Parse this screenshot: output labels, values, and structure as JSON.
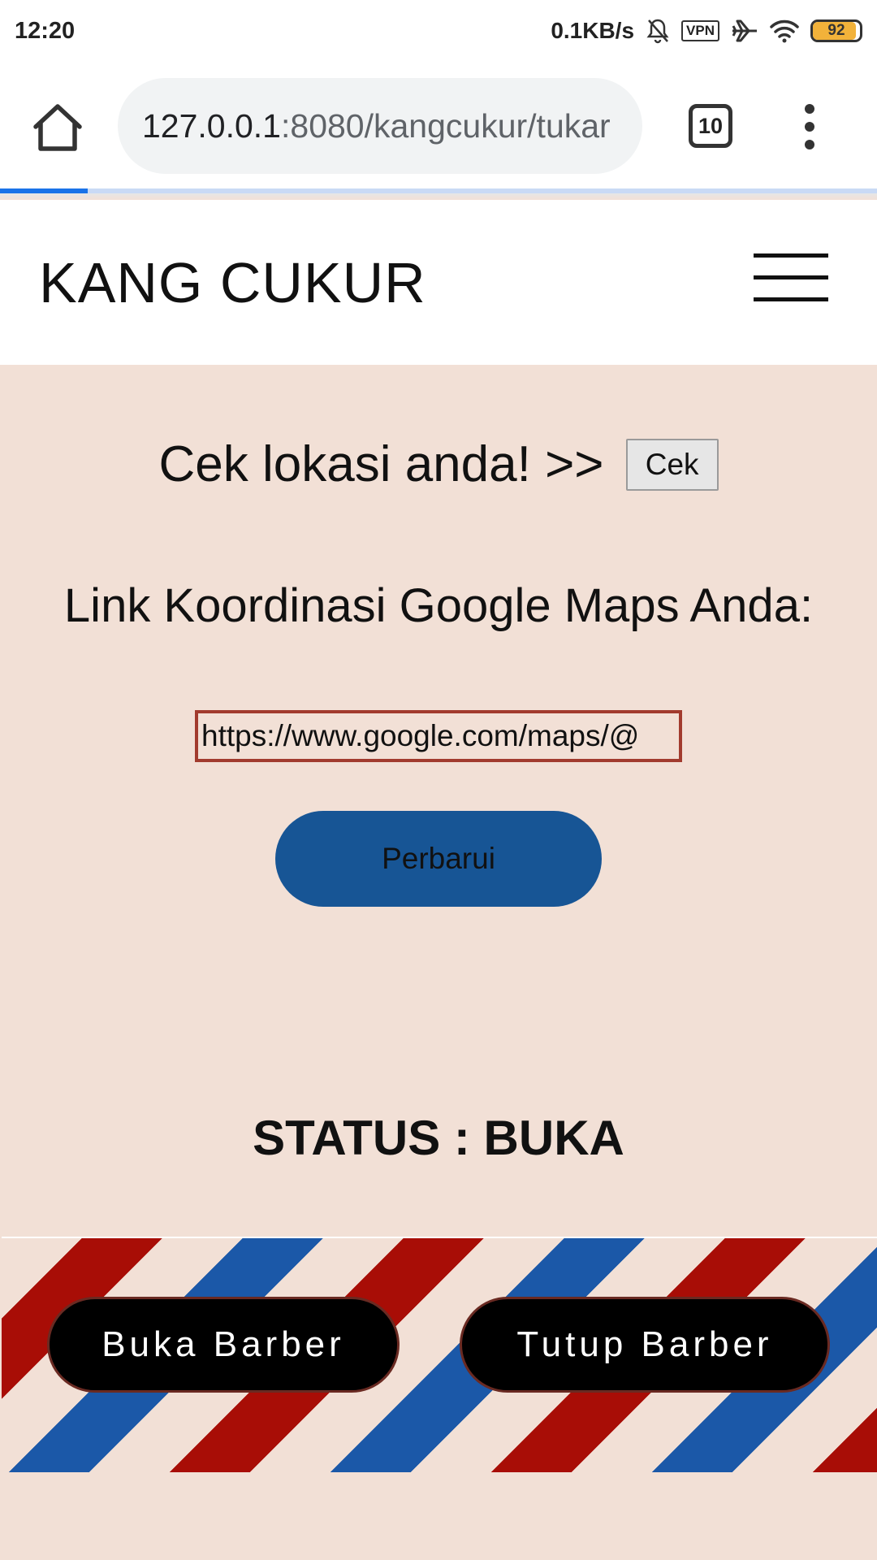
{
  "status_bar": {
    "time": "12:20",
    "network_speed": "0.1KB/s",
    "vpn_label": "VPN",
    "battery_level": "92",
    "icons": [
      "bell-muted-icon",
      "vpn-icon",
      "airplane-icon",
      "wifi-icon",
      "battery-icon"
    ]
  },
  "browser": {
    "url_host": "127.0.0.1",
    "url_path": ":8080/kangcukur/tukar",
    "tab_count": "10",
    "page_load_progress": 0.1
  },
  "site": {
    "title": "KANG CUKUR"
  },
  "main": {
    "cek_prompt": "Cek lokasi anda! >>",
    "cek_button": "Cek",
    "link_heading": "Link Koordinasi Google Maps Anda:",
    "maps_link_value": "https://www.google.com/maps/@",
    "update_button": "Perbarui",
    "status_text": "STATUS : BUKA"
  },
  "actions": {
    "open_button": "Buka Barber",
    "close_button": "Tutup Barber"
  },
  "colors": {
    "page_background": "#f2e0d6",
    "primary_button": "#175595",
    "stripe_red": "#a80d06",
    "stripe_blue": "#1b58a8",
    "input_border": "#a23b2e",
    "browser_progress": "#1a73e8"
  }
}
